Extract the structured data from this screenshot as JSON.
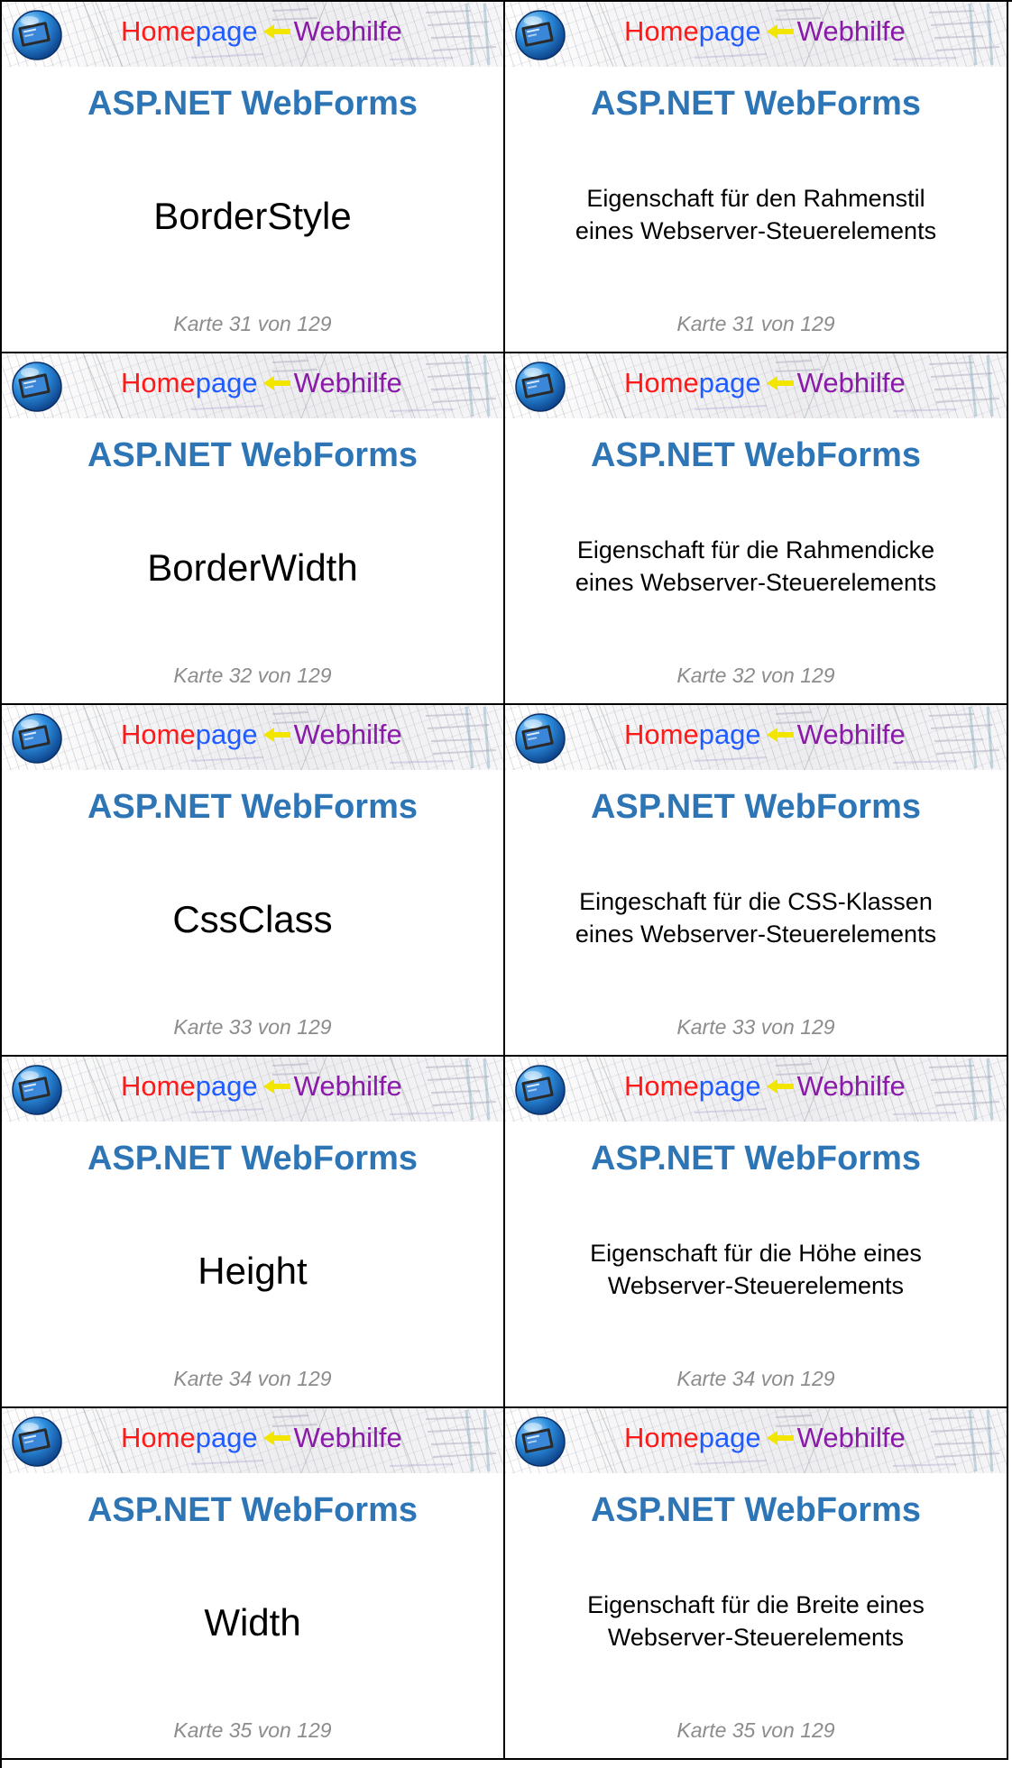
{
  "banner": {
    "home": "Home",
    "page": "page",
    "web": "Webhilfe"
  },
  "colors": {
    "title": "#2e75b6",
    "footer": "#8c8c8c",
    "banner_home": "#ff1a1a",
    "banner_page": "#1f5bff",
    "banner_web": "#8a1aa8",
    "arrow": "#f2e600"
  },
  "cards": [
    {
      "title": "ASP.NET WebForms",
      "term": "BorderStyle",
      "definition_lines": [
        "Eigenschaft für den Rahmenstil",
        "eines Webserver-Steuerelements"
      ],
      "footer": "Karte 31 von 129"
    },
    {
      "title": "ASP.NET WebForms",
      "term": "BorderWidth",
      "definition_lines": [
        "Eigenschaft für die Rahmendicke",
        "eines Webserver-Steuerelements"
      ],
      "footer": "Karte 32 von 129"
    },
    {
      "title": "ASP.NET WebForms",
      "term": "CssClass",
      "definition_lines": [
        "Eingeschaft für die CSS-Klassen",
        "eines Webserver-Steuerelements"
      ],
      "footer": "Karte 33 von 129"
    },
    {
      "title": "ASP.NET WebForms",
      "term": "Height",
      "definition_lines": [
        "Eigenschaft für die Höhe eines",
        "Webserver-Steuerelements"
      ],
      "footer": "Karte 34 von 129"
    },
    {
      "title": "ASP.NET WebForms",
      "term": "Width",
      "definition_lines": [
        "Eigenschaft für die Breite eines",
        "Webserver-Steuerelements"
      ],
      "footer": "Karte 35 von 129"
    }
  ]
}
